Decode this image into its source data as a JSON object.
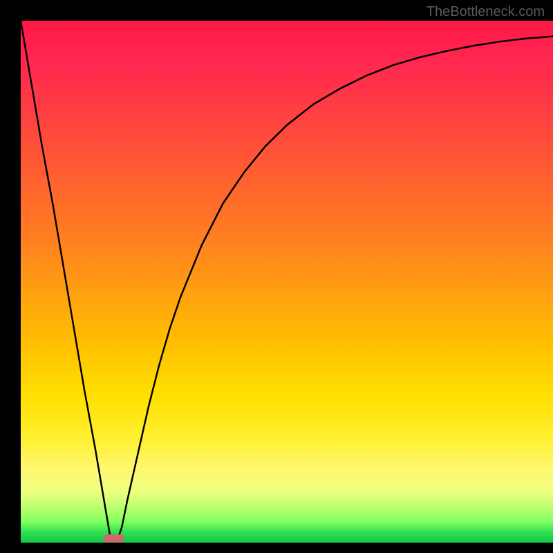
{
  "watermark": "TheBottleneck.com",
  "chart_data": {
    "type": "line",
    "title": "",
    "xlabel": "",
    "ylabel": "",
    "xlim": [
      0,
      100
    ],
    "ylim": [
      0,
      100
    ],
    "grid": false,
    "legend": false,
    "background_gradient": {
      "stops": [
        {
          "pos": 0,
          "color": "#ff1744"
        },
        {
          "pos": 30,
          "color": "#ff6030"
        },
        {
          "pos": 62,
          "color": "#ffc000"
        },
        {
          "pos": 86,
          "color": "#fff870"
        },
        {
          "pos": 100,
          "color": "#10c848"
        }
      ]
    },
    "series": [
      {
        "name": "bottleneck-curve",
        "x": [
          0,
          2,
          4,
          6,
          8,
          10,
          12,
          14,
          16,
          17,
          18,
          19,
          20,
          22,
          24,
          26,
          28,
          30,
          34,
          38,
          42,
          46,
          50,
          55,
          60,
          65,
          70,
          75,
          80,
          85,
          90,
          95,
          100
        ],
        "y": [
          100,
          88,
          76,
          65,
          53,
          41,
          29,
          18,
          6,
          0,
          0,
          3,
          8,
          17,
          26,
          34,
          41,
          47,
          57,
          65,
          71,
          76,
          80,
          84,
          87,
          89.5,
          91.5,
          93,
          94.2,
          95.2,
          96,
          96.6,
          97
        ]
      }
    ],
    "marker": {
      "name": "optimal-range",
      "x_start": 15.5,
      "x_end": 19.5,
      "y": 0,
      "color": "#c96b6b"
    }
  }
}
